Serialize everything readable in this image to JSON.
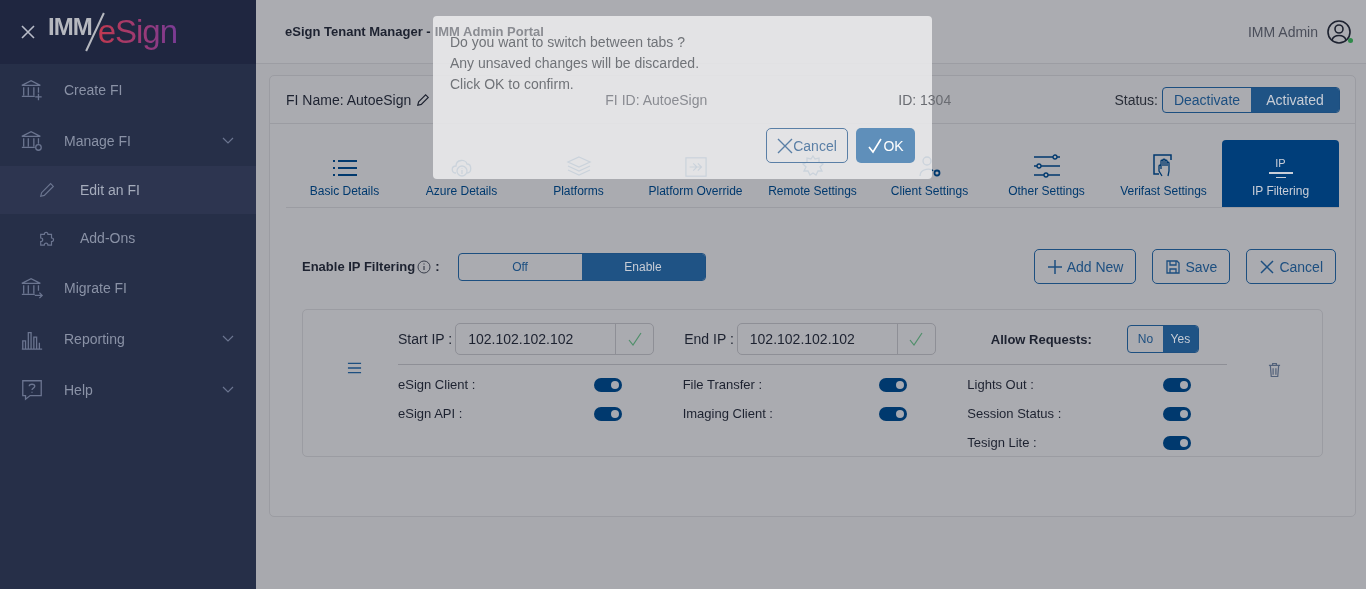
{
  "sidebar": {
    "logo_left": "IMM",
    "logo_right": "eSign",
    "items": [
      {
        "label": "Create FI",
        "selected": false,
        "chevron": false
      },
      {
        "label": "Manage FI",
        "selected": false,
        "chevron": true,
        "children": [
          {
            "label": "Edit an FI",
            "selected": true
          },
          {
            "label": "Add-Ons",
            "selected": false
          }
        ]
      },
      {
        "label": "Migrate FI",
        "selected": false,
        "chevron": false
      },
      {
        "label": "Reporting",
        "selected": false,
        "chevron": true
      },
      {
        "label": "Help",
        "selected": false,
        "chevron": true
      }
    ]
  },
  "header": {
    "title": "eSign Tenant Manager -",
    "subtitle": "IMM Admin Portal",
    "user": "IMM Admin",
    "online": true
  },
  "fi": {
    "name": "FI Name: AutoeSign",
    "fi_id": "FI ID: AutoeSign",
    "id": "ID: 1304",
    "status_label": "Status:",
    "status_options": [
      {
        "label": "Deactivate",
        "selected": false
      },
      {
        "label": "Activated",
        "selected": true
      }
    ]
  },
  "tabs": [
    {
      "label": "Basic Details",
      "selected": false
    },
    {
      "label": "Azure Details",
      "selected": false
    },
    {
      "label": "Platforms",
      "selected": false
    },
    {
      "label": "Platform Override",
      "selected": false
    },
    {
      "label": "Remote Settings",
      "selected": false
    },
    {
      "label": "Client Settings",
      "selected": false
    },
    {
      "label": "Other Settings",
      "selected": false
    },
    {
      "label": "Verifast Settings",
      "selected": false
    },
    {
      "label": "IP Filtering",
      "selected": true,
      "icon_text": "IP"
    }
  ],
  "filtering": {
    "label": "Enable IP Filtering",
    "colon": ":",
    "options": [
      {
        "label": "Off",
        "selected": false
      },
      {
        "label": "Enable",
        "selected": true
      }
    ]
  },
  "actions": [
    "Add New",
    "Save",
    "Cancel"
  ],
  "rule": {
    "start_label": "Start IP :",
    "start_value": "102.102.102.102",
    "end_label": "End IP :",
    "end_value": "102.102.102.102",
    "allow_label": "Allow Requests:",
    "allow_options": [
      {
        "label": "No",
        "selected": false
      },
      {
        "label": "Yes",
        "selected": true
      }
    ],
    "toggle_columns": [
      [
        {
          "label": "eSign Client :",
          "on": true
        },
        {
          "label": "eSign API :",
          "on": true
        }
      ],
      [
        {
          "label": "File Transfer :",
          "on": true
        },
        {
          "label": "Imaging Client :",
          "on": true
        }
      ],
      [
        {
          "label": "Lights Out :",
          "on": true
        },
        {
          "label": "Session Status :",
          "on": true
        },
        {
          "label": "Tesign Lite :",
          "on": true
        }
      ]
    ]
  },
  "dialog": {
    "lines": [
      "Do you want to switch between tabs ?",
      "Any unsaved changes will be discarded.",
      "Click OK to confirm."
    ],
    "buttons": [
      "Cancel",
      "OK"
    ]
  }
}
